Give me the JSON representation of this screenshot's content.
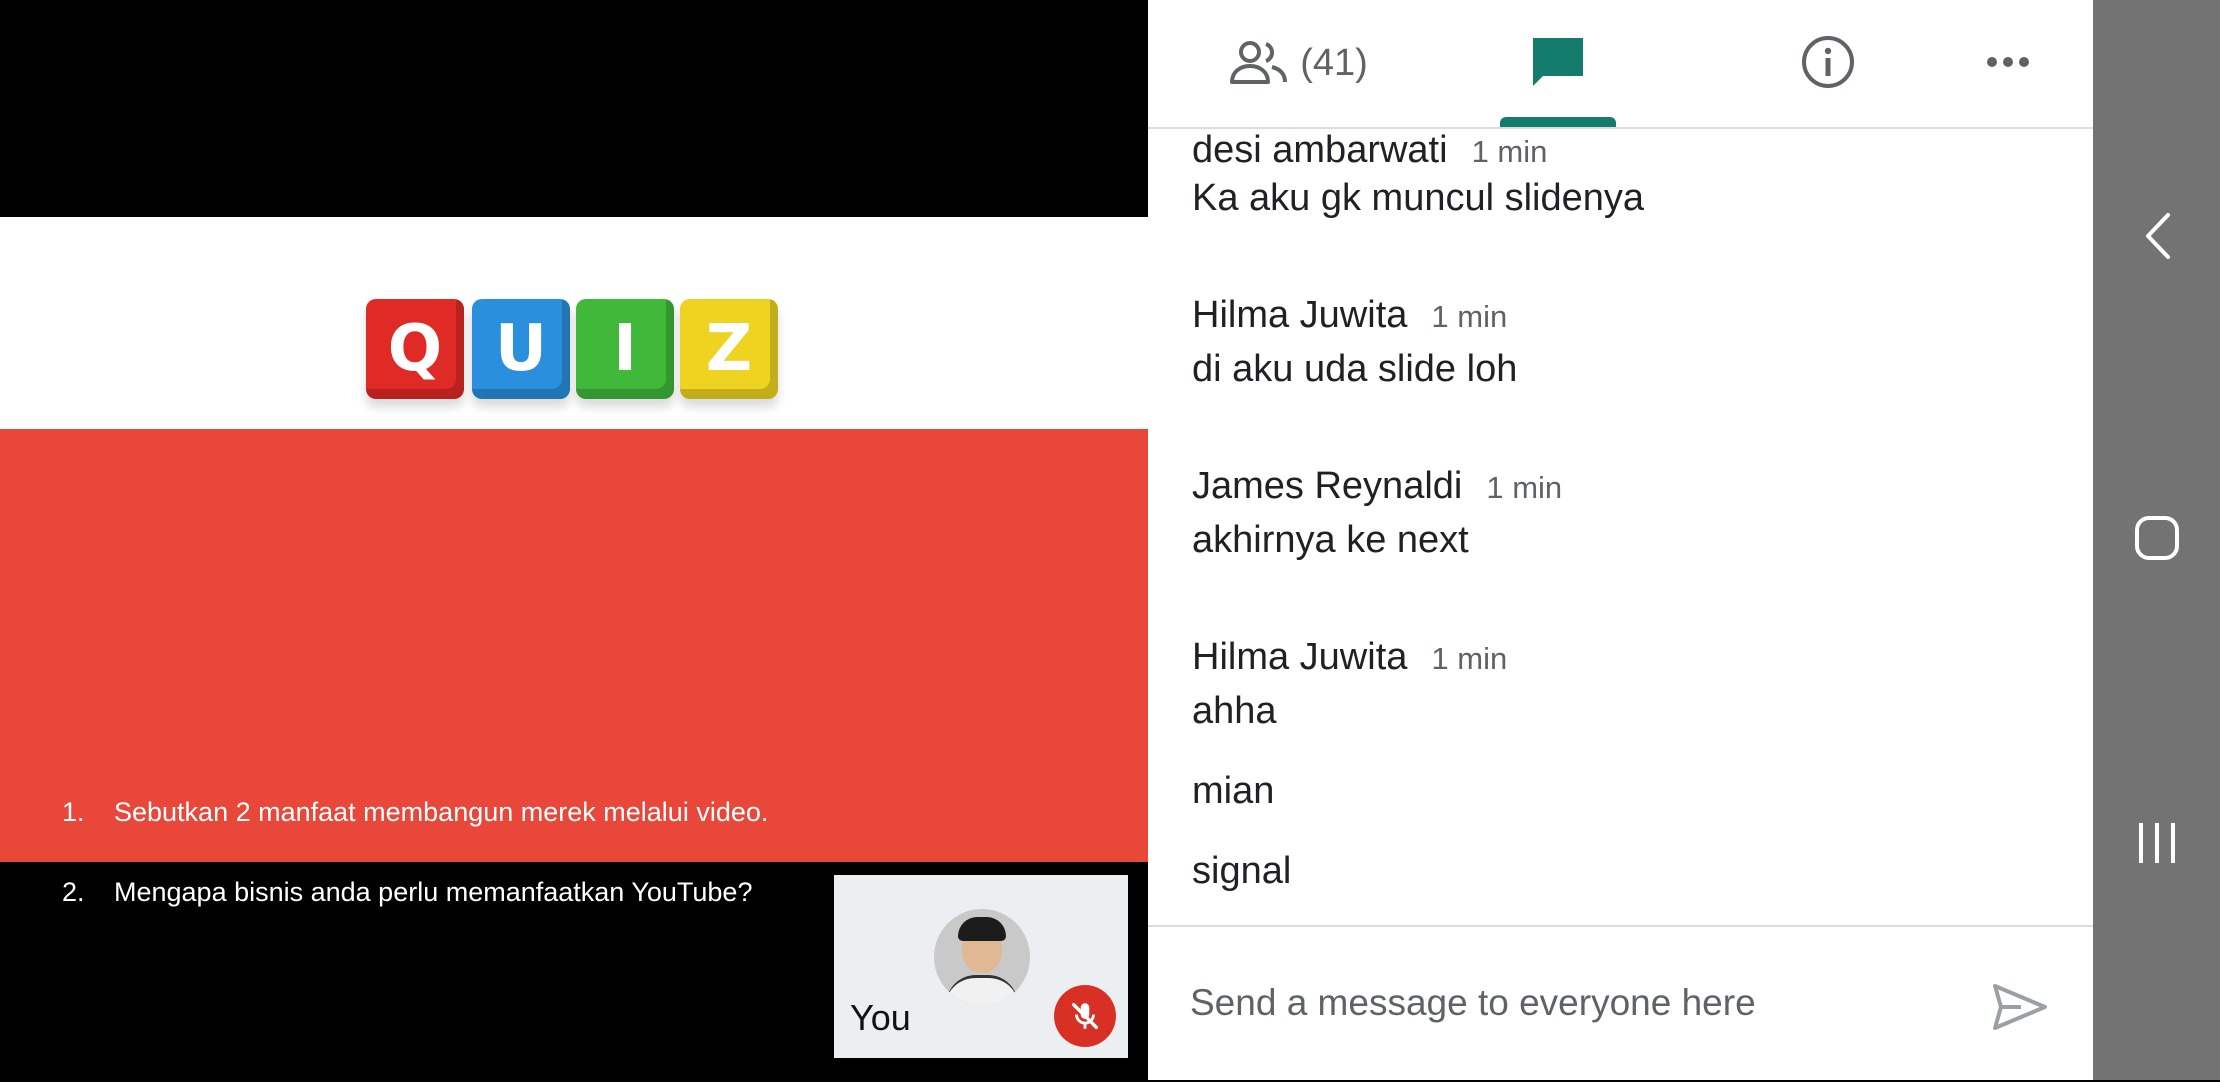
{
  "slide": {
    "quiz_letters": [
      "Q",
      "U",
      "I",
      "Z"
    ],
    "questions": [
      {
        "num": "1.",
        "text": "Sebutkan 2 manfaat membangun merek melalui video."
      },
      {
        "num": "2.",
        "text": "Mengapa bisnis anda perlu memanfaatkan YouTube?"
      }
    ]
  },
  "self_view": {
    "name": "You",
    "mic_icon": "mic-off-icon"
  },
  "tabs": {
    "people_count": "(41)",
    "icons": [
      "people-icon",
      "chat-icon",
      "info-icon",
      "more-icon"
    ],
    "active_color": "#137c6c"
  },
  "chat": {
    "messages": [
      {
        "sender": "desi ambarwati",
        "time": "1 min",
        "lines": [
          "Ka aku gk muncul slidenya"
        ]
      },
      {
        "sender": "Hilma Juwita",
        "time": "1 min",
        "lines": [
          "di aku uda slide loh"
        ]
      },
      {
        "sender": "James Reynaldi",
        "time": "1 min",
        "lines": [
          "akhirnya ke next"
        ]
      },
      {
        "sender": "Hilma Juwita",
        "time": "1 min",
        "lines": [
          "ahha",
          "mian",
          "signal"
        ]
      }
    ]
  },
  "composer": {
    "placeholder": "Send a message to everyone here"
  },
  "navbar": {
    "icons": [
      "back-icon",
      "home-icon",
      "recents-icon"
    ]
  }
}
